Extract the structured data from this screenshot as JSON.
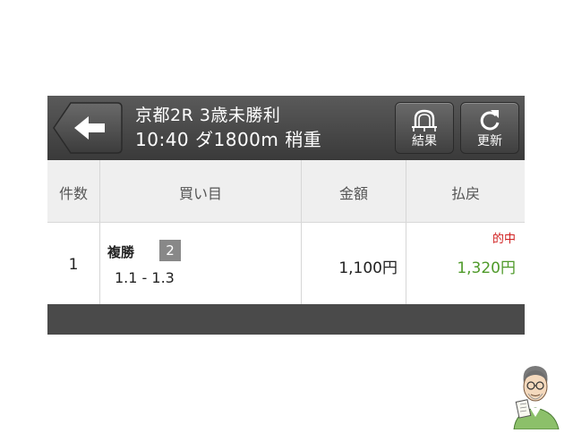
{
  "header": {
    "race_line1": "京都2R 3歳未勝利",
    "race_line2": "10:40 ダ1800m 稍重",
    "back_icon": "arrow-left-icon",
    "result_label": "結果",
    "result_icon": "horseshoe-icon",
    "refresh_label": "更新",
    "refresh_icon": "refresh-icon"
  },
  "table": {
    "columns": [
      "件数",
      "買い目",
      "金額",
      "払戻"
    ],
    "rows": [
      {
        "count": "1",
        "bet_type": "複勝",
        "bet_number": "2",
        "combination": "1.1 - 1.3",
        "amount": "1,100円",
        "hit_label": "的中",
        "payout": "1,320円"
      }
    ]
  },
  "colors": {
    "header_bg": "#3a3a3a",
    "hit": "#d02020",
    "payout": "#4f9a2a"
  }
}
